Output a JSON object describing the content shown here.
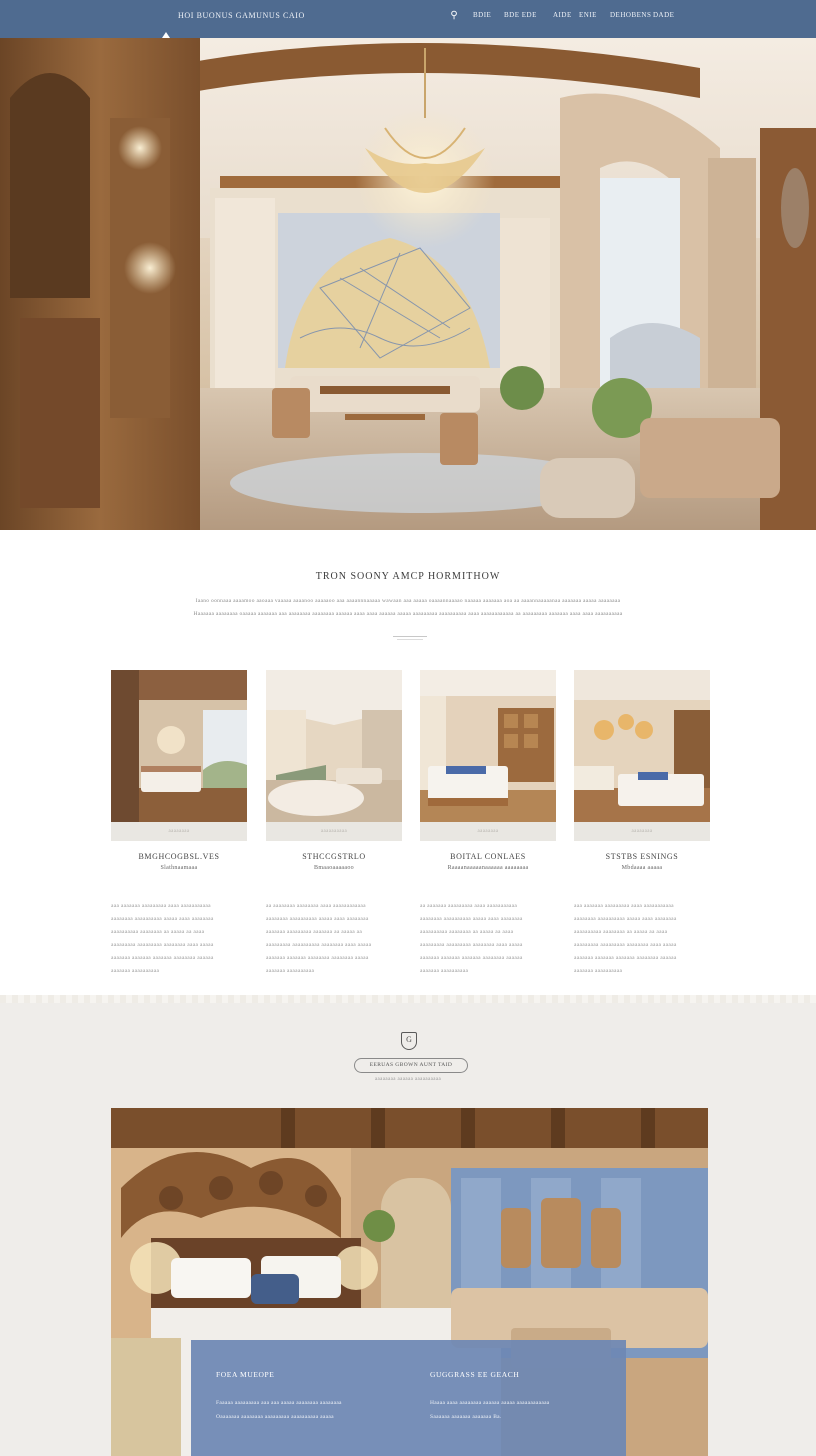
{
  "nav": {
    "brand": "HOI BUONUS GAMUNUS CAIO",
    "search_icon": "search-icon",
    "items": [
      "BDIE",
      "BDE EDE",
      "AIDE",
      "ENIE",
      "DEHOBENS",
      "DADE"
    ]
  },
  "hero": {
    "active_slide": 1,
    "slide_count": 2
  },
  "intro": {
    "title": "TRON SOONY AMCP HORMITHOW",
    "lines": [
      "Iaano oonnaaa aaaamoo aaoaaa vaaaaa aaaanoo aaaaaoo aaa aaaannnaaaaa wawaan aaa aaaaa oaaaannaaaao naaaaa aaaaaaa aoa aa aaaannaaaaanaa aaaaaaa aaaaa aaaaaaaa",
      "Haaaaaa aaaaaaaa oaaaaa aaaaaaa aaa aaaaaaaa aaaaaaaa aaaaaa aaaa aaaa aaaaaa aaaaa aaaaaaaaa aaaaaaaaaa aaaa aaaaaaaaaaaa aa aaaaaaaaa aaaaaaa aaaa aaaa aaaaaaaaaa"
    ]
  },
  "rooms": [
    {
      "strip": "aaaaaaaa",
      "name": "BMGHCOGBSL.VES",
      "sub": "Slathnaamaaa",
      "desc": [
        "aaa aaaaaaa aaaaaaaaa aaaa aaaaaaaaaaa",
        "aaaaaaaa aaaaaaaaaa aaaaa aaaa aaaaaaaa",
        "aaaaaaaaaa aaaaaaaa aa aaaaa aa aaaa",
        "aaaaaaaaa aaaaaaaaa aaaaaaaa aaaa aaaaa",
        "aaaaaaa aaaaaaa aaaaaaa aaaaaaaa aaaaaa",
        "aaaaaaa aaaaaaaaaa"
      ]
    },
    {
      "strip": "aaaaaaaaaa",
      "name": "STHCCGSTRLO",
      "sub": "Bmaaoaaaaaoo",
      "desc": [
        "aa aaaaaaaa aaaaaaaa aaaa aaaaaaaaaaaa",
        "aaaaaaaa aaaaaaaaaa aaaaa aaaa aaaaaaaa",
        "aaaaaaa aaaaaaaaa aaaaaaa aa aaaaa aa",
        "aaaaaaaaa aaaaaaaaaa aaaaaaaa aaaa aaaaa",
        "aaaaaaa aaaaaaa aaaaaaaa aaaaaaaa aaaaa",
        "aaaaaaa aaaaaaaaaa"
      ]
    },
    {
      "strip": "aaaaaaaa",
      "name": "BOITAL CONLAES",
      "sub": "Raaaanaaaaanaaaaaa aaaaaaaa",
      "desc": [
        "aa aaaaaaa aaaaaaaaa aaaa aaaaaaaaaaa",
        "aaaaaaaa aaaaaaaaaa aaaaa aaaa aaaaaaaa",
        "aaaaaaaaaa aaaaaaaa aa aaaaa aa aaaa",
        "aaaaaaaaa aaaaaaaaa aaaaaaaa aaaa aaaaa",
        "aaaaaaa aaaaaaa aaaaaaa aaaaaaaa aaaaaa",
        "aaaaaaa aaaaaaaaaa"
      ]
    },
    {
      "strip": "aaaaaaaa",
      "name": "STSTBS ESNINGS",
      "sub": "Mbdaaaa aaaaa",
      "desc": [
        "aaa aaaaaaa aaaaaaaaa aaaa aaaaaaaaaaa",
        "aaaaaaaa aaaaaaaaaa aaaaa aaaa aaaaaaaa",
        "aaaaaaaaaa aaaaaaaa aa aaaaa aa aaaa",
        "aaaaaaaaa aaaaaaaaa aaaaaaaa aaaa aaaaa",
        "aaaaaaa aaaaaaa aaaaaaa aaaaaaaa aaaaaa",
        "aaaaaaa aaaaaaaaaa"
      ]
    }
  ],
  "lower": {
    "crest_icon": "crest-icon",
    "crest_glyph": "G",
    "button_label": "EERUAS GBOWN AUNT TAID",
    "caption": "aaaaaaaa aaaaaa aaaaaaaaaa",
    "panel": {
      "left_title": "FOEA MUEOPE",
      "left_lines": [
        "Faaaaa aaaaaaaaa aaa aaa aaaaa aaaaaaaa aaaaaaaa",
        "Oaaaaaaa aaaaaaaa aaaaaaaaa aaaaaaaaaa aaaaa"
      ],
      "right_title": "GUGGRASS EE GEACH",
      "right_lines": [
        "Haaaa aaaa aaaaaaaa aaaaaa aaaaa aaaaaaaaaaaa",
        "Saaaaaa aaaaaaa aaaaaaa Ba."
      ]
    }
  },
  "colors": {
    "nav_bg": "#4f6b90",
    "panel_bg": "#6e88b4",
    "lower_bg": "#efedea"
  }
}
